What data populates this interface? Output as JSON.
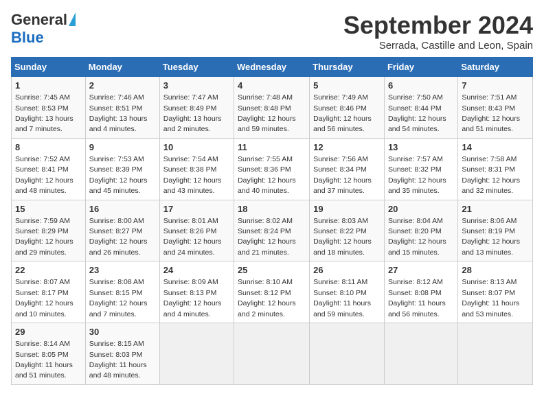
{
  "header": {
    "logo_general": "General",
    "logo_blue": "Blue",
    "month_title": "September 2024",
    "location": "Serrada, Castille and Leon, Spain"
  },
  "weekdays": [
    "Sunday",
    "Monday",
    "Tuesday",
    "Wednesday",
    "Thursday",
    "Friday",
    "Saturday"
  ],
  "weeks": [
    [
      {
        "day": "1",
        "sunrise": "Sunrise: 7:45 AM",
        "sunset": "Sunset: 8:53 PM",
        "daylight": "Daylight: 13 hours and 7 minutes."
      },
      {
        "day": "2",
        "sunrise": "Sunrise: 7:46 AM",
        "sunset": "Sunset: 8:51 PM",
        "daylight": "Daylight: 13 hours and 4 minutes."
      },
      {
        "day": "3",
        "sunrise": "Sunrise: 7:47 AM",
        "sunset": "Sunset: 8:49 PM",
        "daylight": "Daylight: 13 hours and 2 minutes."
      },
      {
        "day": "4",
        "sunrise": "Sunrise: 7:48 AM",
        "sunset": "Sunset: 8:48 PM",
        "daylight": "Daylight: 12 hours and 59 minutes."
      },
      {
        "day": "5",
        "sunrise": "Sunrise: 7:49 AM",
        "sunset": "Sunset: 8:46 PM",
        "daylight": "Daylight: 12 hours and 56 minutes."
      },
      {
        "day": "6",
        "sunrise": "Sunrise: 7:50 AM",
        "sunset": "Sunset: 8:44 PM",
        "daylight": "Daylight: 12 hours and 54 minutes."
      },
      {
        "day": "7",
        "sunrise": "Sunrise: 7:51 AM",
        "sunset": "Sunset: 8:43 PM",
        "daylight": "Daylight: 12 hours and 51 minutes."
      }
    ],
    [
      {
        "day": "8",
        "sunrise": "Sunrise: 7:52 AM",
        "sunset": "Sunset: 8:41 PM",
        "daylight": "Daylight: 12 hours and 48 minutes."
      },
      {
        "day": "9",
        "sunrise": "Sunrise: 7:53 AM",
        "sunset": "Sunset: 8:39 PM",
        "daylight": "Daylight: 12 hours and 45 minutes."
      },
      {
        "day": "10",
        "sunrise": "Sunrise: 7:54 AM",
        "sunset": "Sunset: 8:38 PM",
        "daylight": "Daylight: 12 hours and 43 minutes."
      },
      {
        "day": "11",
        "sunrise": "Sunrise: 7:55 AM",
        "sunset": "Sunset: 8:36 PM",
        "daylight": "Daylight: 12 hours and 40 minutes."
      },
      {
        "day": "12",
        "sunrise": "Sunrise: 7:56 AM",
        "sunset": "Sunset: 8:34 PM",
        "daylight": "Daylight: 12 hours and 37 minutes."
      },
      {
        "day": "13",
        "sunrise": "Sunrise: 7:57 AM",
        "sunset": "Sunset: 8:32 PM",
        "daylight": "Daylight: 12 hours and 35 minutes."
      },
      {
        "day": "14",
        "sunrise": "Sunrise: 7:58 AM",
        "sunset": "Sunset: 8:31 PM",
        "daylight": "Daylight: 12 hours and 32 minutes."
      }
    ],
    [
      {
        "day": "15",
        "sunrise": "Sunrise: 7:59 AM",
        "sunset": "Sunset: 8:29 PM",
        "daylight": "Daylight: 12 hours and 29 minutes."
      },
      {
        "day": "16",
        "sunrise": "Sunrise: 8:00 AM",
        "sunset": "Sunset: 8:27 PM",
        "daylight": "Daylight: 12 hours and 26 minutes."
      },
      {
        "day": "17",
        "sunrise": "Sunrise: 8:01 AM",
        "sunset": "Sunset: 8:26 PM",
        "daylight": "Daylight: 12 hours and 24 minutes."
      },
      {
        "day": "18",
        "sunrise": "Sunrise: 8:02 AM",
        "sunset": "Sunset: 8:24 PM",
        "daylight": "Daylight: 12 hours and 21 minutes."
      },
      {
        "day": "19",
        "sunrise": "Sunrise: 8:03 AM",
        "sunset": "Sunset: 8:22 PM",
        "daylight": "Daylight: 12 hours and 18 minutes."
      },
      {
        "day": "20",
        "sunrise": "Sunrise: 8:04 AM",
        "sunset": "Sunset: 8:20 PM",
        "daylight": "Daylight: 12 hours and 15 minutes."
      },
      {
        "day": "21",
        "sunrise": "Sunrise: 8:06 AM",
        "sunset": "Sunset: 8:19 PM",
        "daylight": "Daylight: 12 hours and 13 minutes."
      }
    ],
    [
      {
        "day": "22",
        "sunrise": "Sunrise: 8:07 AM",
        "sunset": "Sunset: 8:17 PM",
        "daylight": "Daylight: 12 hours and 10 minutes."
      },
      {
        "day": "23",
        "sunrise": "Sunrise: 8:08 AM",
        "sunset": "Sunset: 8:15 PM",
        "daylight": "Daylight: 12 hours and 7 minutes."
      },
      {
        "day": "24",
        "sunrise": "Sunrise: 8:09 AM",
        "sunset": "Sunset: 8:13 PM",
        "daylight": "Daylight: 12 hours and 4 minutes."
      },
      {
        "day": "25",
        "sunrise": "Sunrise: 8:10 AM",
        "sunset": "Sunset: 8:12 PM",
        "daylight": "Daylight: 12 hours and 2 minutes."
      },
      {
        "day": "26",
        "sunrise": "Sunrise: 8:11 AM",
        "sunset": "Sunset: 8:10 PM",
        "daylight": "Daylight: 11 hours and 59 minutes."
      },
      {
        "day": "27",
        "sunrise": "Sunrise: 8:12 AM",
        "sunset": "Sunset: 8:08 PM",
        "daylight": "Daylight: 11 hours and 56 minutes."
      },
      {
        "day": "28",
        "sunrise": "Sunrise: 8:13 AM",
        "sunset": "Sunset: 8:07 PM",
        "daylight": "Daylight: 11 hours and 53 minutes."
      }
    ],
    [
      {
        "day": "29",
        "sunrise": "Sunrise: 8:14 AM",
        "sunset": "Sunset: 8:05 PM",
        "daylight": "Daylight: 11 hours and 51 minutes."
      },
      {
        "day": "30",
        "sunrise": "Sunrise: 8:15 AM",
        "sunset": "Sunset: 8:03 PM",
        "daylight": "Daylight: 11 hours and 48 minutes."
      },
      null,
      null,
      null,
      null,
      null
    ]
  ]
}
